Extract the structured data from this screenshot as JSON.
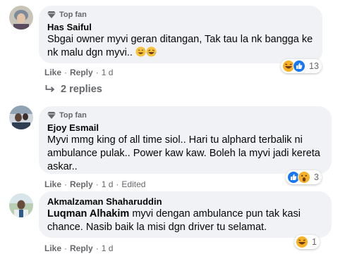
{
  "comments": [
    {
      "badge": "Top fan",
      "author": "Has Saiful",
      "text": "Sbgai owner myvi geran ditangan, Tak tau la nk bangga ke nk malu dgn myvi..",
      "emojis": [
        "grinning-sweat-emoji",
        "rofl-emoji"
      ],
      "actions": {
        "like": "Like",
        "reply": "Reply",
        "time": "1 d"
      },
      "reactions": {
        "icons": [
          "haha",
          "like"
        ],
        "count": "13"
      },
      "replies_label": "2 replies"
    },
    {
      "badge": "Top fan",
      "author": "Ejoy Esmail",
      "text": "Myvi mmg king of all time siol.. Hari tu alphard terbalik ni ambulance pulak.. Power kaw kaw. Boleh la myvi jadi kereta askar..",
      "actions": {
        "like": "Like",
        "reply": "Reply",
        "time": "1 d",
        "edited": "Edited"
      },
      "reactions": {
        "icons": [
          "like",
          "wow"
        ],
        "count": "3"
      }
    },
    {
      "author": "Akmalzaman Shaharuddin",
      "mention": "Luqman Alhakim",
      "text": " myvi dengan ambulance pun tak kasi chance. Nasib baik la misi dgn driver tu selamat.",
      "actions": {
        "like": "Like",
        "reply": "Reply",
        "time": "1 d"
      },
      "reactions": {
        "icons": [
          "haha"
        ],
        "count": "1"
      }
    }
  ],
  "colors": {
    "bubble": "#f0f2f5",
    "meta": "#65676b",
    "like_blue": "#1877f2",
    "haha_yellow": "#f7b125"
  }
}
